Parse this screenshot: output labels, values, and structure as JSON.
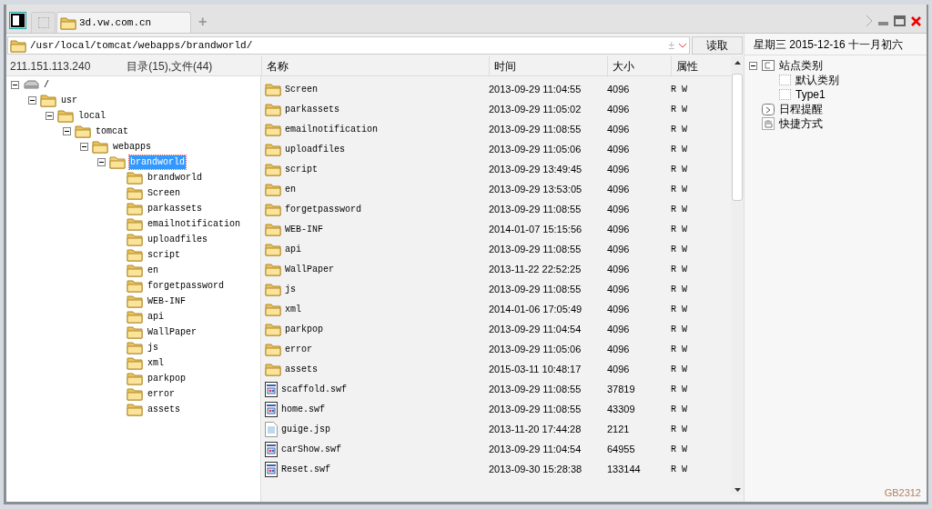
{
  "tabs": [
    {
      "kind": "blank",
      "selected": false
    },
    {
      "kind": "folder",
      "label": "3d.vw.com.cn",
      "selected": true
    }
  ],
  "tab_add": "+",
  "address": {
    "value": "/usr/local/tomcat/webapps/brandworld/",
    "sign": "±",
    "button": "读取"
  },
  "date_line": "星期三 2015-12-16 十一月初六",
  "tree_header": {
    "host": "211.151.113.240",
    "counts": "目录(15),文件(44)"
  },
  "tree": [
    {
      "label": "/",
      "kind": "drive",
      "expanded": true,
      "selected": false,
      "children": [
        {
          "label": "usr",
          "kind": "folder",
          "expanded": true,
          "selected": false,
          "children": [
            {
              "label": "local",
              "kind": "folder",
              "expanded": true,
              "selected": false,
              "children": [
                {
                  "label": "tomcat",
                  "kind": "folder",
                  "expanded": true,
                  "selected": false,
                  "children": [
                    {
                      "label": "webapps",
                      "kind": "folder",
                      "expanded": true,
                      "selected": false,
                      "children": [
                        {
                          "label": "brandworld",
                          "kind": "folder",
                          "expanded": true,
                          "selected": true,
                          "children": [
                            {
                              "label": "brandworld",
                              "kind": "folder",
                              "selected": false
                            },
                            {
                              "label": "Screen",
                              "kind": "folder",
                              "selected": false
                            },
                            {
                              "label": "parkassets",
                              "kind": "folder",
                              "selected": false
                            },
                            {
                              "label": "emailnotification",
                              "kind": "folder",
                              "selected": false
                            },
                            {
                              "label": "uploadfiles",
                              "kind": "folder",
                              "selected": false
                            },
                            {
                              "label": "script",
                              "kind": "folder",
                              "selected": false
                            },
                            {
                              "label": "en",
                              "kind": "folder",
                              "selected": false
                            },
                            {
                              "label": "forgetpassword",
                              "kind": "folder",
                              "selected": false
                            },
                            {
                              "label": "WEB-INF",
                              "kind": "folder",
                              "selected": false
                            },
                            {
                              "label": "api",
                              "kind": "folder",
                              "selected": false
                            },
                            {
                              "label": "WallPaper",
                              "kind": "folder",
                              "selected": false
                            },
                            {
                              "label": "js",
                              "kind": "folder",
                              "selected": false
                            },
                            {
                              "label": "xml",
                              "kind": "folder",
                              "selected": false
                            },
                            {
                              "label": "parkpop",
                              "kind": "folder",
                              "selected": false
                            },
                            {
                              "label": "error",
                              "kind": "folder",
                              "selected": false
                            },
                            {
                              "label": "assets",
                              "kind": "folder",
                              "selected": false
                            }
                          ]
                        }
                      ]
                    }
                  ]
                }
              ]
            }
          ]
        }
      ]
    }
  ],
  "file_table": {
    "columns": [
      "名称",
      "时间",
      "大小",
      "属性"
    ],
    "rows": [
      {
        "kind": "folder",
        "name": "Screen",
        "time": "2013-09-29 11:04:55",
        "size": "4096",
        "attr": "R W"
      },
      {
        "kind": "folder",
        "name": "parkassets",
        "time": "2013-09-29 11:05:02",
        "size": "4096",
        "attr": "R W"
      },
      {
        "kind": "folder",
        "name": "emailnotification",
        "time": "2013-09-29 11:08:55",
        "size": "4096",
        "attr": "R W"
      },
      {
        "kind": "folder",
        "name": "uploadfiles",
        "time": "2013-09-29 11:05:06",
        "size": "4096",
        "attr": "R W"
      },
      {
        "kind": "folder",
        "name": "script",
        "time": "2013-09-29 13:49:45",
        "size": "4096",
        "attr": "R W"
      },
      {
        "kind": "folder",
        "name": "en",
        "time": "2013-09-29 13:53:05",
        "size": "4096",
        "attr": "R W"
      },
      {
        "kind": "folder",
        "name": "forgetpassword",
        "time": "2013-09-29 11:08:55",
        "size": "4096",
        "attr": "R W"
      },
      {
        "kind": "folder",
        "name": "WEB-INF",
        "time": "2014-01-07 15:15:56",
        "size": "4096",
        "attr": "R W"
      },
      {
        "kind": "folder",
        "name": "api",
        "time": "2013-09-29 11:08:55",
        "size": "4096",
        "attr": "R W"
      },
      {
        "kind": "folder",
        "name": "WallPaper",
        "time": "2013-11-22 22:52:25",
        "size": "4096",
        "attr": "R W"
      },
      {
        "kind": "folder",
        "name": "js",
        "time": "2013-09-29 11:08:55",
        "size": "4096",
        "attr": "R W"
      },
      {
        "kind": "folder",
        "name": "xml",
        "time": "2014-01-06 17:05:49",
        "size": "4096",
        "attr": "R W"
      },
      {
        "kind": "folder",
        "name": "parkpop",
        "time": "2013-09-29 11:04:54",
        "size": "4096",
        "attr": "R W"
      },
      {
        "kind": "folder",
        "name": "error",
        "time": "2013-09-29 11:05:06",
        "size": "4096",
        "attr": "R W"
      },
      {
        "kind": "folder",
        "name": "assets",
        "time": "2015-03-11 10:48:17",
        "size": "4096",
        "attr": "R W"
      },
      {
        "kind": "swf",
        "name": "scaffold.swf",
        "time": "2013-09-29 11:08:55",
        "size": "37819",
        "attr": "R W"
      },
      {
        "kind": "swf",
        "name": "home.swf",
        "time": "2013-09-29 11:08:55",
        "size": "43309",
        "attr": "R W"
      },
      {
        "kind": "jsp",
        "name": "guige.jsp",
        "time": "2013-11-20 17:44:28",
        "size": "2121",
        "attr": "R W"
      },
      {
        "kind": "swf",
        "name": "carShow.swf",
        "time": "2013-09-29 11:04:54",
        "size": "64955",
        "attr": "R W"
      },
      {
        "kind": "swf",
        "name": "Reset.swf",
        "time": "2013-09-30 15:28:38",
        "size": "133144",
        "attr": "R W"
      }
    ]
  },
  "side_tree": [
    {
      "kind": "category",
      "label": "站点类别",
      "expanded": true,
      "children": [
        {
          "label": "默认类别"
        },
        {
          "label": "Type1"
        }
      ]
    },
    {
      "kind": "schedule",
      "label": "日程提醒"
    },
    {
      "kind": "shortcut",
      "label": "快捷方式"
    }
  ],
  "status_bar": {
    "encoding": "GB2312"
  }
}
